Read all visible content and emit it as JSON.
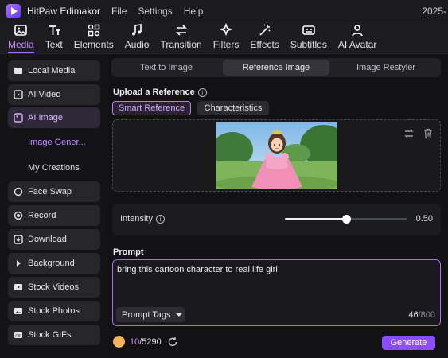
{
  "app": {
    "title": "HitPaw Edimakor",
    "date": "2025-"
  },
  "menu": [
    "File",
    "Settings",
    "Help"
  ],
  "toolbar": [
    {
      "label": "Media",
      "icon": "image-icon",
      "active": true
    },
    {
      "label": "Text",
      "icon": "text-icon"
    },
    {
      "label": "Elements",
      "icon": "elements-icon"
    },
    {
      "label": "Audio",
      "icon": "music-icon"
    },
    {
      "label": "Transition",
      "icon": "transition-icon"
    },
    {
      "label": "Filters",
      "icon": "sparkle-icon"
    },
    {
      "label": "Effects",
      "icon": "magic-wand-icon"
    },
    {
      "label": "Subtitles",
      "icon": "subtitles-icon"
    },
    {
      "label": "AI Avatar",
      "icon": "avatar-icon"
    }
  ],
  "sidebar": {
    "items": [
      {
        "label": "Local Media",
        "icon": "folder-icon"
      },
      {
        "label": "AI Video",
        "icon": "ai-video-icon"
      },
      {
        "label": "AI Image",
        "icon": "ai-image-icon",
        "active": true
      },
      {
        "label": "Face Swap",
        "icon": "face-swap-icon"
      },
      {
        "label": "Record",
        "icon": "record-icon"
      },
      {
        "label": "Download",
        "icon": "download-icon"
      },
      {
        "label": "Background",
        "icon": "triangle-right-icon"
      },
      {
        "label": "Stock Videos",
        "icon": "stock-video-icon"
      },
      {
        "label": "Stock Photos",
        "icon": "stock-photo-icon"
      },
      {
        "label": "Stock GIFs",
        "icon": "gif-icon"
      }
    ],
    "sub_items": [
      {
        "label": "Image Gener...",
        "active": true
      },
      {
        "label": "My Creations"
      }
    ]
  },
  "tabs": [
    {
      "label": "Text to Image"
    },
    {
      "label": "Reference Image",
      "active": true
    },
    {
      "label": "Image Restyler"
    }
  ],
  "upload": {
    "label": "Upload a Reference",
    "info_icon": "i",
    "mode_smart": "Smart Reference",
    "mode_characteristics": "Characteristics"
  },
  "intensity": {
    "label": "Intensity",
    "info_icon": "i",
    "value": "0.50",
    "level": 0.5
  },
  "prompt": {
    "label": "Prompt",
    "text": "bring this cartoon character to real life girl",
    "tags_label": "Prompt Tags",
    "count": "46",
    "max": "/800"
  },
  "footer": {
    "credits_used": "10",
    "credits_total": "/5290",
    "generate_label": "Generate"
  },
  "colors": {
    "accent": "#a56cff",
    "generate": "#8a4dff",
    "background": "#121214"
  }
}
